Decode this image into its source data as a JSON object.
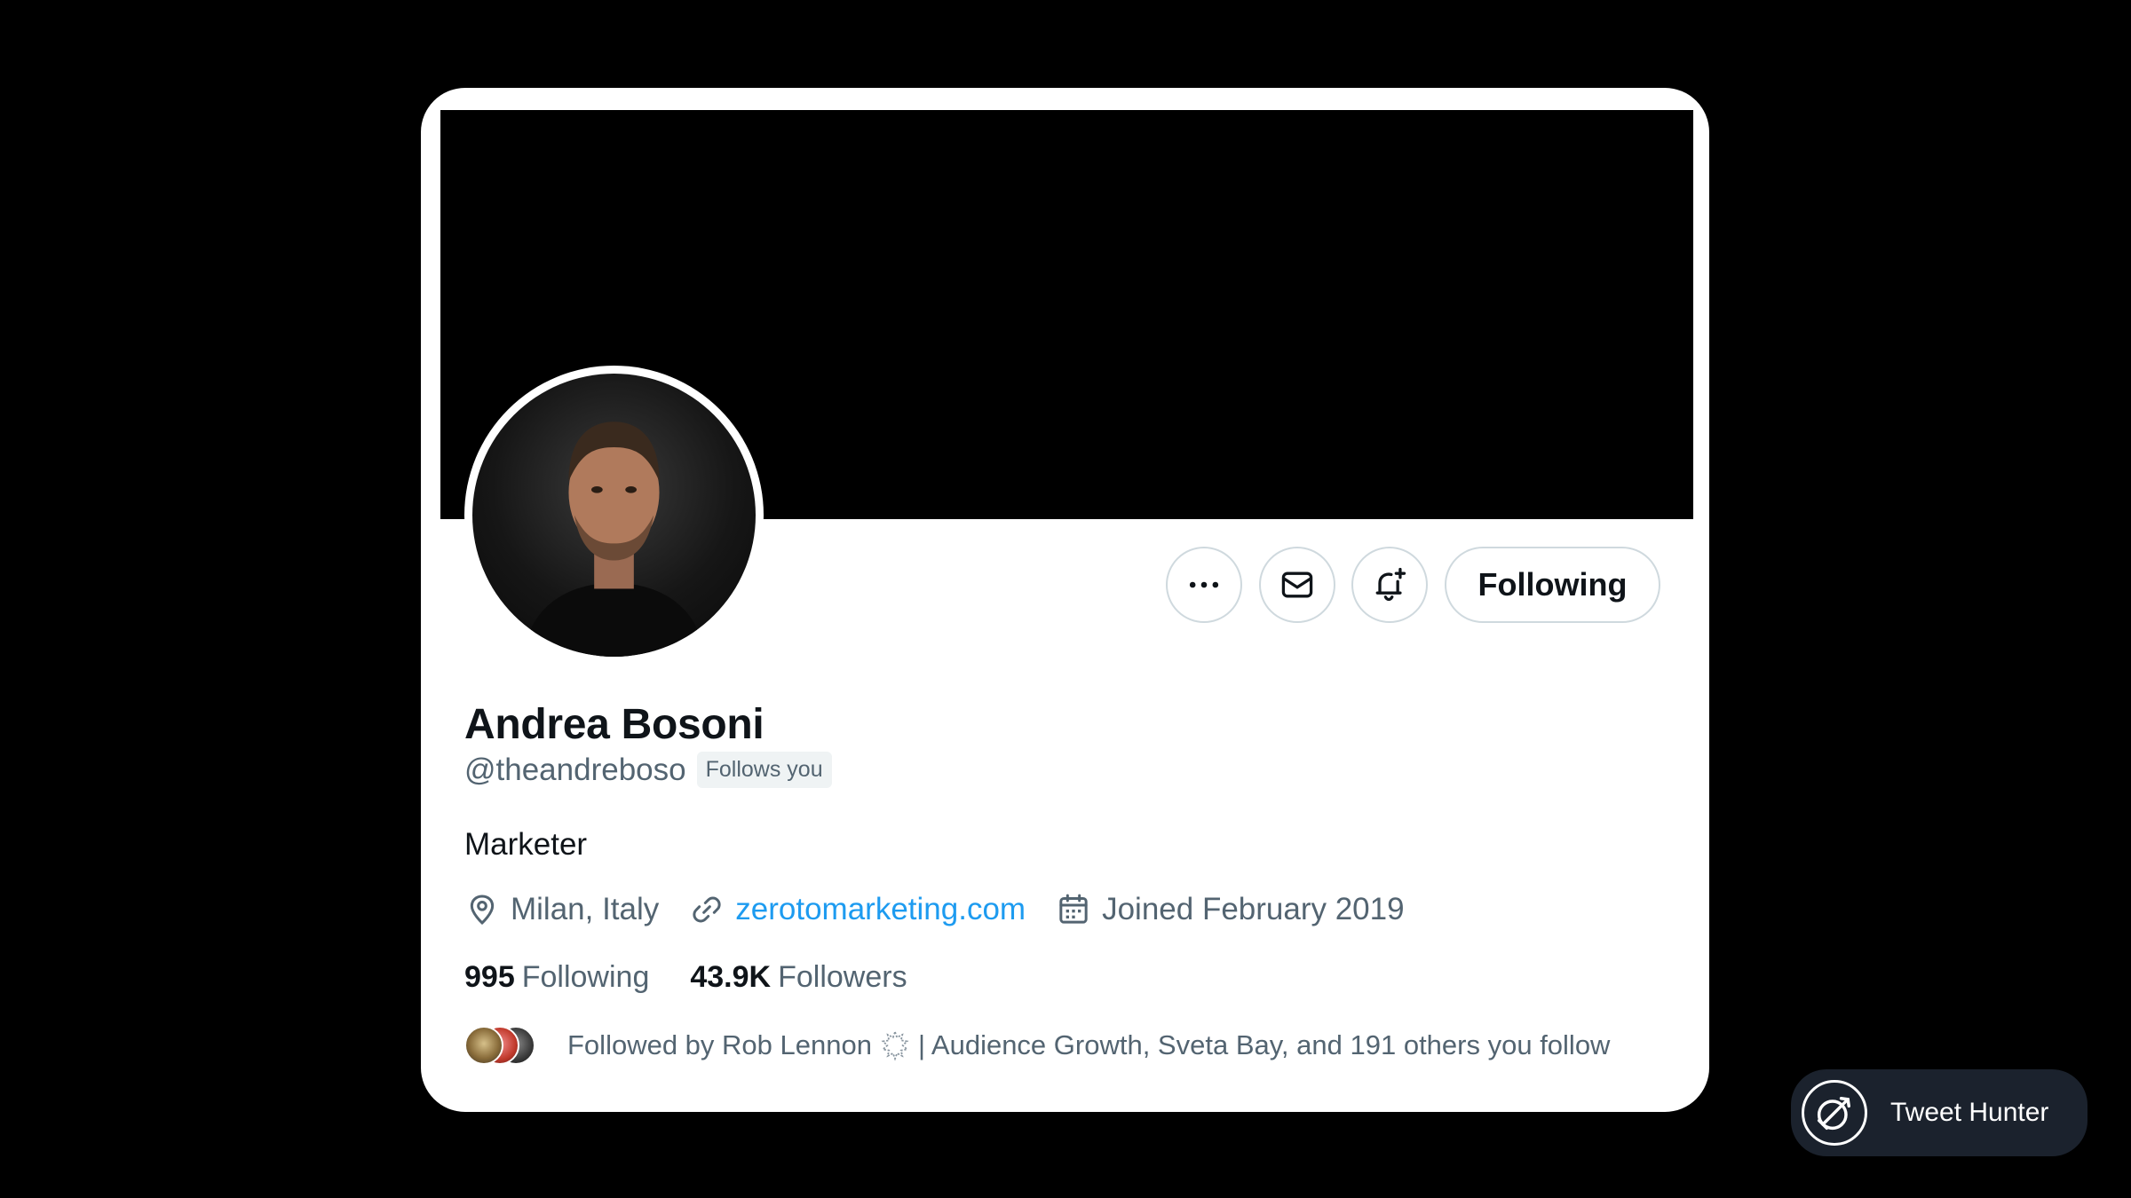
{
  "profile": {
    "name": "Andrea Bosoni",
    "handle": "@theandreboso",
    "follows_you": "Follows you",
    "bio": "Marketer",
    "location": "Milan, Italy",
    "website": "zerotomarketing.com",
    "joined": "Joined February 2019"
  },
  "actions": {
    "more_icon": "more-horizontal-icon",
    "message_icon": "mail-icon",
    "notify_icon": "bell-plus-icon",
    "following_label": "Following"
  },
  "stats": {
    "following_count": "995",
    "following_label": "Following",
    "followers_count": "43.9K",
    "followers_label": "Followers"
  },
  "followed_by": {
    "prefix": "Followed by Rob Lennon",
    "suffix": "| Audience Growth, Sveta Bay, and 191 others you follow"
  },
  "brand": {
    "label": "Tweet Hunter",
    "logo_icon": "target-arrow-icon"
  },
  "colors": {
    "link": "#1d9bf0",
    "secondary_text": "#536471",
    "primary_text": "#0f1419",
    "border": "#cfd9de",
    "badge_bg": "#eff3f4",
    "pill_bg": "#1b222d"
  }
}
